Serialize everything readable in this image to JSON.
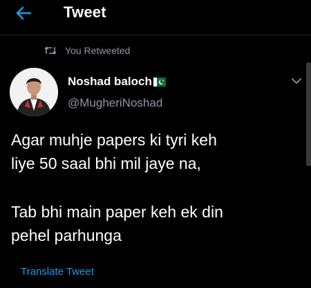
{
  "header": {
    "title": "Tweet",
    "back_icon": "arrow-left-icon"
  },
  "colors": {
    "accent": "#1d9bf0",
    "muted": "#8b98a5",
    "background": "#000000"
  },
  "retweet_context": {
    "icon": "retweet-icon",
    "text": "You Retweeted"
  },
  "author": {
    "name": "Noshad baloch",
    "flag_icon": "pakistan-flag-icon",
    "handle": "@MugheriNoshad"
  },
  "tweet": {
    "paragraph1_line1": "Agar muhje papers ki tyri keh",
    "paragraph1_line2": "liye 50 saal bhi mil jaye na,",
    "paragraph2_line1": "Tab bhi main paper keh ek din",
    "paragraph2_line2": "pehel parhunga"
  },
  "translate_label": "Translate Tweet"
}
